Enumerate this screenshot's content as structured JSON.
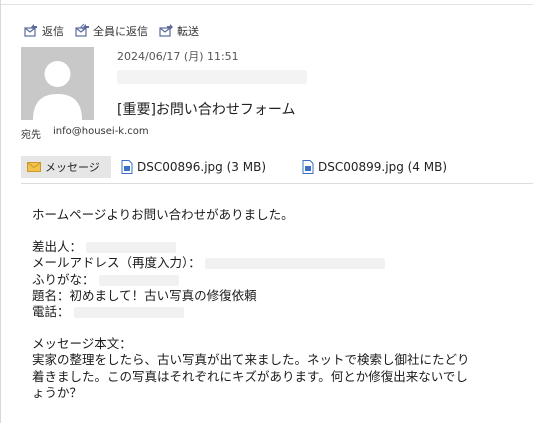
{
  "toolbar": {
    "reply": "返信",
    "reply_all": "全員に返信",
    "forward": "転送"
  },
  "header": {
    "date": "2024/06/17 (月) 11:51",
    "subject": "[重要]お問い合わせフォーム",
    "to_label": "宛先",
    "to_value": "info@housei-k.com"
  },
  "attachments": {
    "message_tab": "メッセージ",
    "files": [
      {
        "name": "DSC00896.jpg (3 MB)"
      },
      {
        "name": "DSC00899.jpg (4 MB)"
      }
    ]
  },
  "body": {
    "intro": "ホームページよりお問い合わせがありました。",
    "sender_label": "差出人：",
    "email_label": "メールアドレス（再度入力）：",
    "furigana_label": "ふりがな：",
    "title_line": "題名：初めまして！古い写真の修復依頼",
    "phone_label": "電話：",
    "message_label": "メッセージ本文：",
    "message_line1": "実家の整理をしたら、古い写真が出て来ました。ネットで検索し御社にたどり",
    "message_line2": "着きました。この写真はそれぞれにキズがあります。何とか修復出来ないでし",
    "message_line3": "ょうか？"
  },
  "colors": {
    "accent_icon": "#5b6b9b",
    "attachment_icon": "#3b6fc7",
    "avatar_bg": "#c8c8c8"
  }
}
